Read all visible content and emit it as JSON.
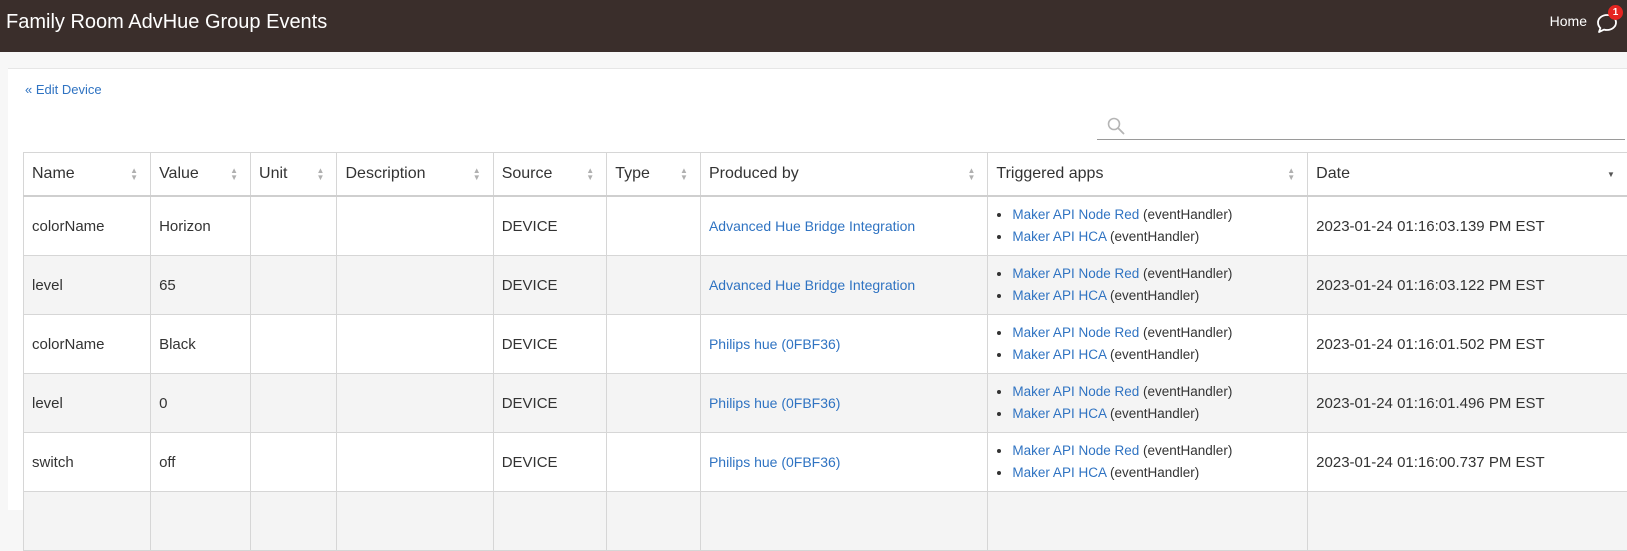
{
  "header": {
    "title": "Family Room AdvHue Group Events",
    "home_label": "Home",
    "notification_count": "1"
  },
  "nav": {
    "back_label": "« Edit Device"
  },
  "search": {
    "value": "",
    "placeholder": ""
  },
  "table": {
    "columns": [
      "Name",
      "Value",
      "Unit",
      "Description",
      "Source",
      "Type",
      "Produced by",
      "Triggered apps",
      "Date"
    ],
    "sorted_column": "Date",
    "sort_direction": "descending",
    "rows": [
      {
        "name": "colorName",
        "value": "Horizon",
        "unit": "",
        "description": "",
        "source": "DEVICE",
        "type": "",
        "produced_by": "Advanced Hue Bridge Integration",
        "apps": [
          {
            "app": "Maker API Node Red",
            "handler": "(eventHandler)"
          },
          {
            "app": "Maker API HCA",
            "handler": "(eventHandler)"
          }
        ],
        "date": "2023-01-24 01:16:03.139 PM EST"
      },
      {
        "name": "level",
        "value": "65",
        "unit": "",
        "description": "",
        "source": "DEVICE",
        "type": "",
        "produced_by": "Advanced Hue Bridge Integration",
        "apps": [
          {
            "app": "Maker API Node Red",
            "handler": "(eventHandler)"
          },
          {
            "app": "Maker API HCA",
            "handler": "(eventHandler)"
          }
        ],
        "date": "2023-01-24 01:16:03.122 PM EST"
      },
      {
        "name": "colorName",
        "value": "Black",
        "unit": "",
        "description": "",
        "source": "DEVICE",
        "type": "",
        "produced_by": "Philips hue (0FBF36)",
        "apps": [
          {
            "app": "Maker API Node Red",
            "handler": "(eventHandler)"
          },
          {
            "app": "Maker API HCA",
            "handler": "(eventHandler)"
          }
        ],
        "date": "2023-01-24 01:16:01.502 PM EST"
      },
      {
        "name": "level",
        "value": "0",
        "unit": "",
        "description": "",
        "source": "DEVICE",
        "type": "",
        "produced_by": "Philips hue (0FBF36)",
        "apps": [
          {
            "app": "Maker API Node Red",
            "handler": "(eventHandler)"
          },
          {
            "app": "Maker API HCA",
            "handler": "(eventHandler)"
          }
        ],
        "date": "2023-01-24 01:16:01.496 PM EST"
      },
      {
        "name": "switch",
        "value": "off",
        "unit": "",
        "description": "",
        "source": "DEVICE",
        "type": "",
        "produced_by": "Philips hue (0FBF36)",
        "apps": [
          {
            "app": "Maker API Node Red",
            "handler": "(eventHandler)"
          },
          {
            "app": "Maker API HCA",
            "handler": "(eventHandler)"
          }
        ],
        "date": "2023-01-24 01:16:00.737 PM EST"
      },
      {
        "name": "",
        "value": "",
        "unit": "",
        "description": "",
        "source": "",
        "type": "",
        "produced_by": "",
        "apps": [],
        "date": ""
      }
    ]
  },
  "icons": {
    "search": "search-icon",
    "notifications": "chat-bubble-icon",
    "sort": "sort-arrows-icon"
  },
  "colors": {
    "header_bg": "#3a2e2b",
    "link": "#2f73c2",
    "badge": "#e52521"
  }
}
